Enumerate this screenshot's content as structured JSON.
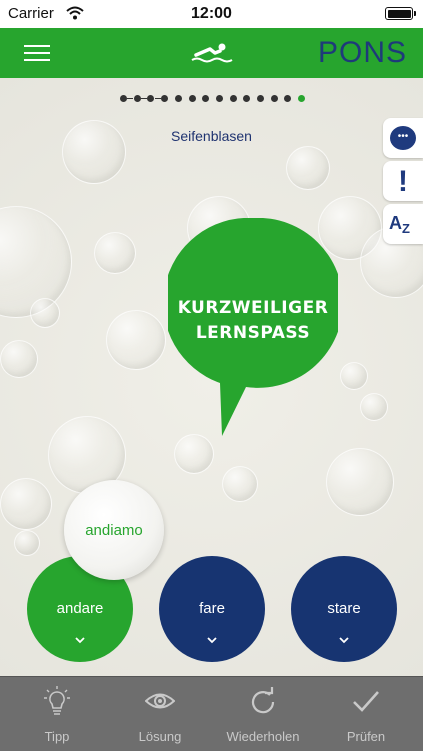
{
  "status": {
    "carrier": "Carrier",
    "time": "12:00"
  },
  "navbar": {
    "brand": "PONS",
    "menu_icon": "hamburger-menu-icon",
    "mode_icon": "swimmer-icon"
  },
  "progress": {
    "total": 14,
    "current": 14
  },
  "level": {
    "title": "Seifenblasen"
  },
  "side_tools": [
    "chat-bubble-icon",
    "exclamation-icon",
    "az-sort-icon"
  ],
  "side_tools_az": {
    "a": "A",
    "z": "Z"
  },
  "speech_bubble": {
    "line1": "KURZWEILIGER",
    "line2": "LERNSPASS"
  },
  "drag_word": "andiamo",
  "answers": [
    {
      "label": "andare",
      "color": "#27a52e"
    },
    {
      "label": "fare",
      "color": "#173471"
    },
    {
      "label": "stare",
      "color": "#173471"
    }
  ],
  "toolbar": [
    {
      "label": "Tipp",
      "icon": "lightbulb-icon"
    },
    {
      "label": "Lösung",
      "icon": "eye-icon"
    },
    {
      "label": "Wiederholen",
      "icon": "repeat-icon"
    },
    {
      "label": "Prüfen",
      "icon": "checkmark-icon"
    }
  ],
  "colors": {
    "brand_green": "#27a52e",
    "brand_blue": "#173471",
    "toolbar_gray": "#6e6e6e"
  }
}
